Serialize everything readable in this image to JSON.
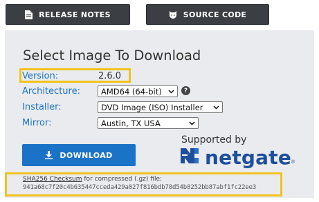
{
  "top_buttons": {
    "release_notes": "RELEASE NOTES",
    "source_code": "SOURCE CODE"
  },
  "panel": {
    "title": "Select Image To Download",
    "version": {
      "label": "Version:",
      "value": "2.6.0"
    },
    "architecture": {
      "label": "Architecture:",
      "value": "AMD64 (64-bit)"
    },
    "installer": {
      "label": "Installer:",
      "value": "DVD Image (ISO) Installer"
    },
    "mirror": {
      "label": "Mirror:",
      "value": "Austin, TX USA"
    },
    "help_glyph": "?",
    "download_label": "DOWNLOAD",
    "supported_by": "Supported by",
    "sponsor_name": "netgate",
    "checksum": {
      "link": "SHA256 Checksum",
      "text": " for compressed (.gz) file:",
      "hash": "941a68c7f20c4b635447cceda429a027f816bdb78d54b8252bb87abf1fc22ee3"
    }
  },
  "colors": {
    "accent": "#1b73c7",
    "highlight": "#f3c21b",
    "dark_button": "#3b3f44",
    "logo": "#1f4e9b"
  }
}
